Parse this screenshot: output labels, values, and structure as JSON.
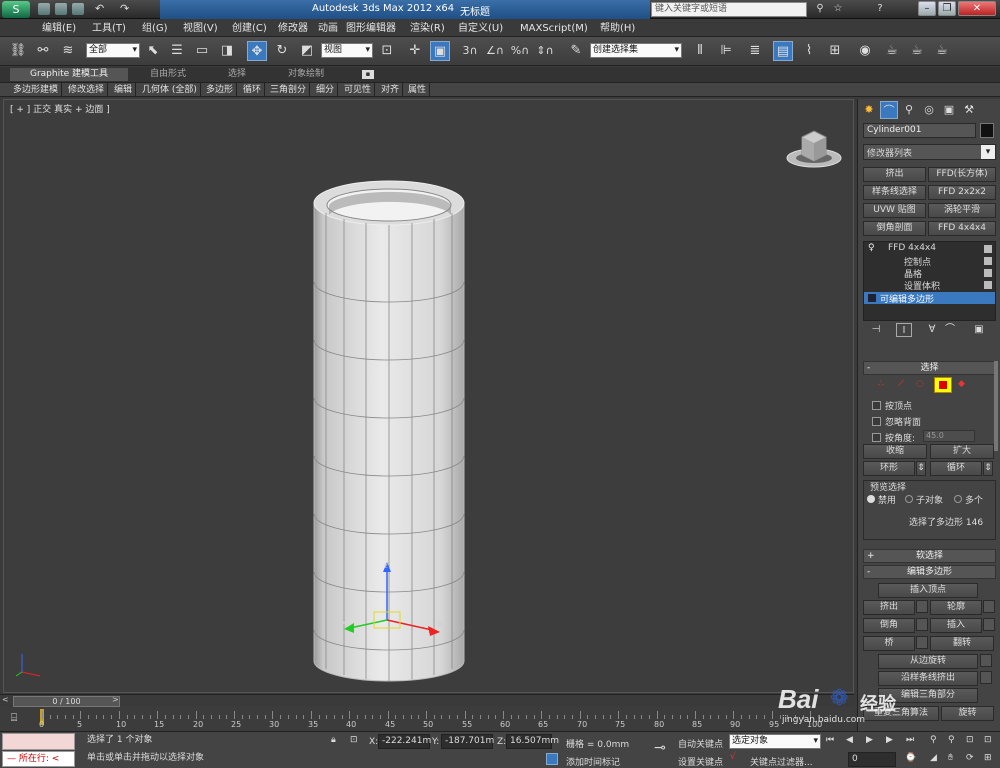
{
  "window": {
    "title": "Autodesk 3ds Max  2012 x64",
    "doc_title": "无标题",
    "search_placeholder": "键入关键字或短语"
  },
  "menu": [
    "编辑(E)",
    "工具(T)",
    "组(G)",
    "视图(V)",
    "创建(C)",
    "修改器",
    "动画",
    "图形编辑器",
    "渲染(R)",
    "自定义(U)",
    "MAXScript(M)",
    "帮助(H)"
  ],
  "toolbar": {
    "selection_filter": "全部",
    "ref_coord": "视图",
    "named_selection": "创建选择集"
  },
  "ribbon": {
    "tabs": [
      "Graphite 建模工具",
      "自由形式",
      "选择",
      "对象绘制"
    ],
    "items": [
      "多边形建模",
      "修改选择",
      "编辑",
      "几何体 (全部)",
      "多边形",
      "循环",
      "三角剖分",
      "细分",
      "可见性",
      "对齐",
      "属性"
    ]
  },
  "viewport": {
    "label": "[ + ] 正交 ] 真实 + 边面 ]",
    "label_parts": [
      "[ + ]",
      "正交",
      "真实",
      "+ 边面",
      "]"
    ]
  },
  "panel": {
    "object_name": "Cylinder001",
    "modifier_list": "修改器列表",
    "mod_buttons": [
      "挤出",
      "FFD(长方体)",
      "样条线选择",
      "FFD 2x2x2",
      "UVW 贴图",
      "涡轮平滑",
      "倒角剖面",
      "FFD 4x4x4"
    ],
    "stack": [
      {
        "label": "FFD 4x4x4"
      },
      {
        "label": "控制点"
      },
      {
        "label": "晶格"
      },
      {
        "label": "设置体积"
      },
      {
        "label": "可编辑多边形"
      }
    ],
    "select_rollout": "选择",
    "by_vertex": "按顶点",
    "ignore_back": "忽略背面",
    "by_angle": "按角度:",
    "angle_value": "45.0",
    "shrink": "收缩",
    "grow": "扩大",
    "ring": "环形",
    "loop": "循环",
    "preview_title": "预览选择",
    "preview_opts": [
      "禁用",
      "子对象",
      "多个"
    ],
    "selected_info": "选择了多边形 146",
    "soft_select": "软选择",
    "edit_poly": "编辑多边形",
    "insert_vertex": "插入顶点",
    "extrude": "挤出",
    "outline": "轮廓",
    "bevel": "倒角",
    "inset": "插入",
    "bridge": "桥",
    "flip": "翻转",
    "hinge": "从边旋转",
    "extrude_spline": "沿样条线挤出",
    "edit_tri": "编辑三角部分",
    "retri": "重复三角算法",
    "turn": "旋转"
  },
  "timeline": {
    "frame": "0 / 100",
    "ticks": [
      "0",
      "5",
      "10",
      "15",
      "20",
      "25",
      "30",
      "35",
      "40",
      "45",
      "50",
      "55",
      "60",
      "65",
      "70",
      "75",
      "80",
      "85",
      "90",
      "95",
      "100"
    ]
  },
  "status": {
    "now": "所在行:",
    "selected": "选择了 1 个对象",
    "prompt": "单击或单击并拖动以选择对象",
    "x_label": "X:",
    "x": "-222.241m",
    "y_label": "Y:",
    "y": "-187.701m",
    "z_label": "Z:",
    "z": "16.507mm",
    "grid": "栅格 = 0.0mm",
    "add_time_tag": "添加时间标记",
    "auto_key": "自动关键点",
    "set_key": "设置关键点",
    "selected_obj": "选定对象",
    "key_filters": "关键点过滤器...",
    "frame_val": "0"
  },
  "watermark": {
    "brand": "Bai",
    "brand2": "经验",
    "url": "jingyan.baidu.com"
  }
}
